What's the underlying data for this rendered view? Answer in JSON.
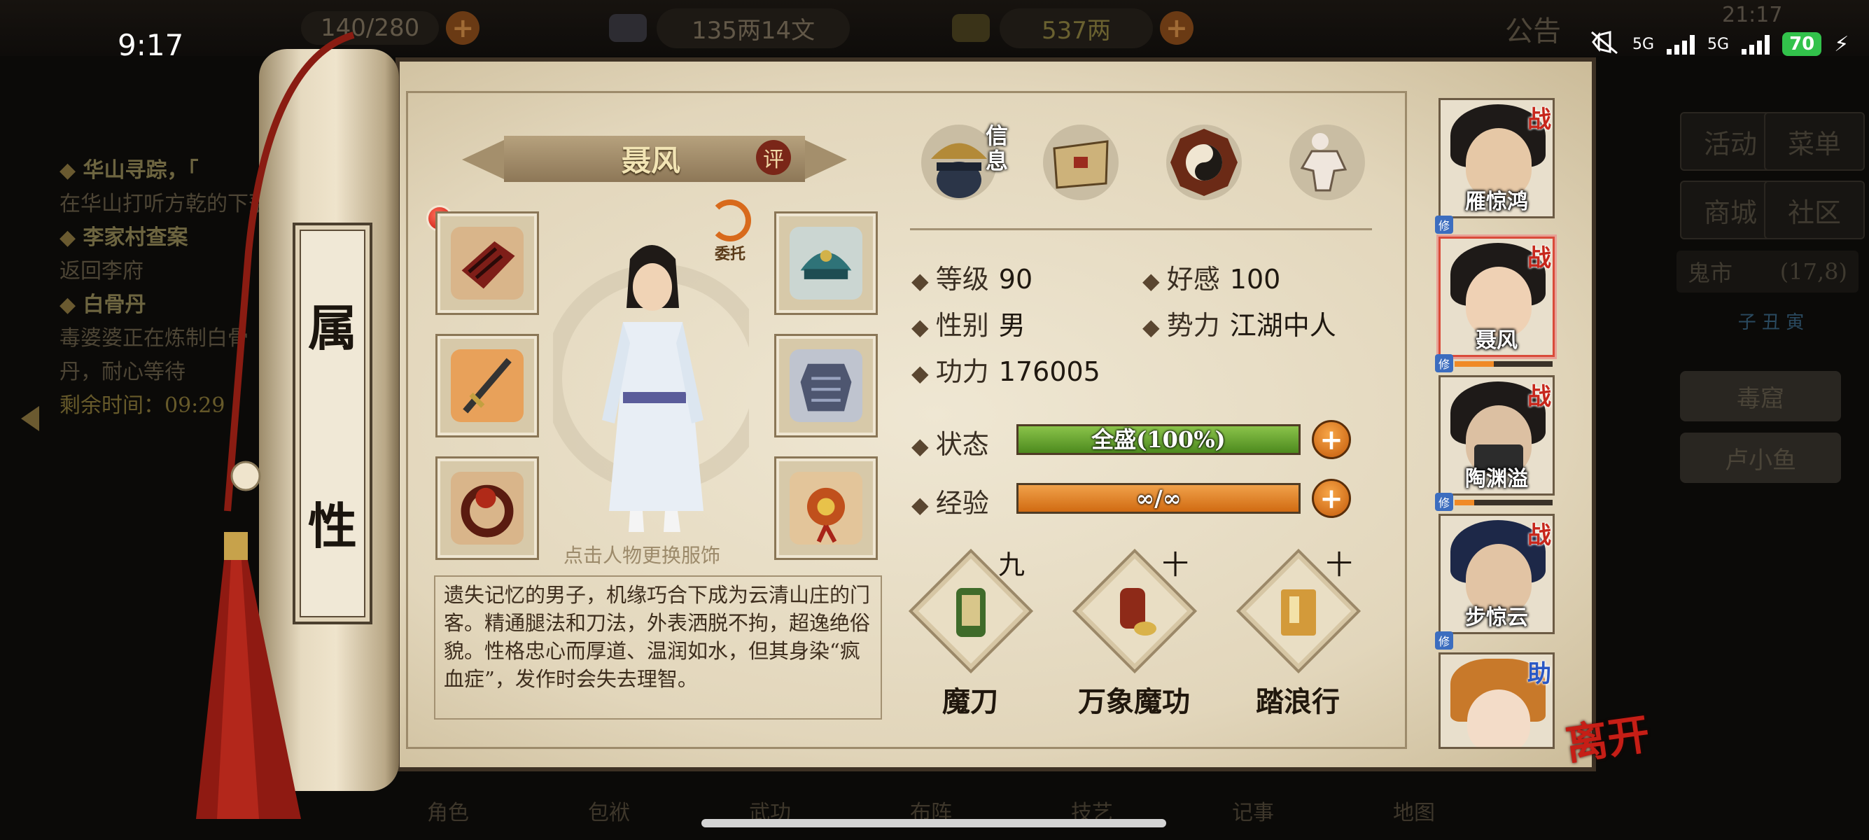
{
  "status_bar": {
    "time": "9:17",
    "network_1": "5G",
    "network_2": "5G",
    "battery": "70"
  },
  "top_bar": {
    "stamina_value": "140/280",
    "silver": "135两14文",
    "gold": "537两",
    "notice": "公告",
    "clock": "21:17"
  },
  "quest_log": {
    "quests": [
      {
        "title": "华山寻踪，「",
        "desc": "在华山打听方乾的下落"
      },
      {
        "title": "李家村查案",
        "desc": "返回李府"
      },
      {
        "title": "白骨丹",
        "desc": "毒婆婆正在炼制白骨丹，耐心等待"
      }
    ],
    "remaining": "剩余时间：09:29"
  },
  "right_menu": {
    "buttons": [
      "活动",
      "菜单",
      "商城",
      "社区"
    ],
    "market": "鬼市",
    "market_coords": "(17,8)",
    "time_marks": "子 丑 寅",
    "slots": [
      "毒窟",
      "卢小鱼"
    ]
  },
  "bottom_nav": [
    "角色",
    "包袱",
    "武功",
    "布阵",
    "技艺",
    "记事",
    "地图"
  ],
  "scroll_label": [
    "属",
    "性"
  ],
  "hero": {
    "name": "聂风",
    "rate_label": "评",
    "entrust_label": "委托",
    "change_outfit_hint": "点击人物更换服饰",
    "description": "遗失记忆的男子，机缘巧合下成为云清山庄的门客。精通腿法和刀法，外表洒脱不拘，超逸绝俗貌。性格忠心而厚道、温润如水，但其身染“疯血症”，发作时会失去理智。"
  },
  "equipment": [
    "bracer-icon",
    "blade-icon",
    "ring-icon",
    "helmet-icon",
    "armor-icon",
    "charm-icon"
  ],
  "tabs": {
    "info_label": "信息",
    "icons": [
      "info-tab-icon",
      "map-scroll-icon",
      "bagua-icon",
      "meridian-icon"
    ]
  },
  "stats": {
    "level_label": "等级",
    "level": "90",
    "favor_label": "好感",
    "favor": "100",
    "gender_label": "性别",
    "gender": "男",
    "faction_label": "势力",
    "faction": "江湖中人",
    "power_label": "功力",
    "power": "176005",
    "state_label": "状态",
    "state": "全盛(100%)",
    "state_fill": 1.0,
    "exp_label": "经验",
    "exp": "∞/∞",
    "exp_fill": 1.0
  },
  "skills": [
    {
      "name": "魔刀",
      "level": "九"
    },
    {
      "name": "万象魔功",
      "level": "十"
    },
    {
      "name": "踏浪行",
      "level": "十"
    }
  ],
  "roster": [
    {
      "name": "雁惊鸿",
      "tag": "战",
      "badge": "修",
      "selected": false
    },
    {
      "name": "聂风",
      "tag": "战",
      "badge": "修",
      "selected": true
    },
    {
      "name": "陶渊溢",
      "tag": "战",
      "badge": "修",
      "selected": false
    },
    {
      "name": "步惊云",
      "tag": "战",
      "badge": "修",
      "selected": false
    },
    {
      "name": "",
      "tag": "助",
      "badge": "",
      "selected": false
    }
  ],
  "leave_label": "离开",
  "colors": {
    "paper": "#e8ddc4",
    "state_bar": "#6aa632",
    "exp_bar": "#e3842c",
    "selected_border": "#d94b3a",
    "battle_tag": "#c7261b",
    "assist_tag": "#2957c4"
  }
}
